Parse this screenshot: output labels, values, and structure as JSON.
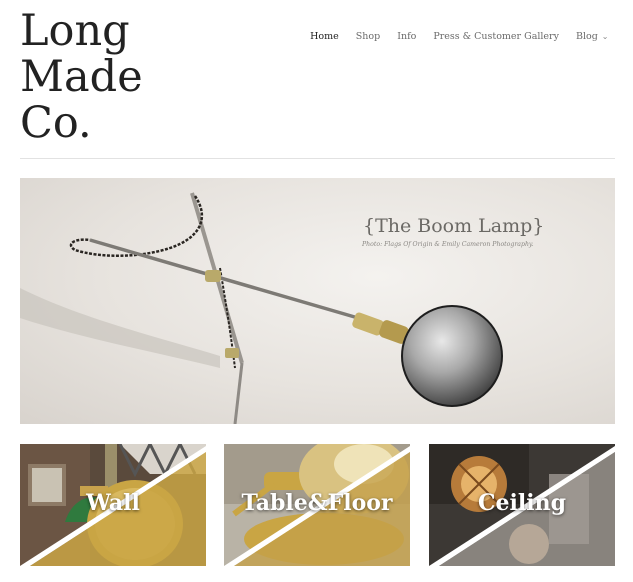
{
  "brand": {
    "line1": "Long",
    "line2": "Made",
    "line3": "Co."
  },
  "nav": {
    "items": [
      {
        "label": "Home"
      },
      {
        "label": "Shop"
      },
      {
        "label": "Info"
      },
      {
        "label": "Press & Customer Gallery"
      },
      {
        "label": "Blog"
      }
    ]
  },
  "hero": {
    "title": "{The Boom Lamp}",
    "credit": "Photo: Flags Of Origin & Emily Cameron Photography."
  },
  "tiles": [
    {
      "label": "Wall"
    },
    {
      "label": "Table&Floor"
    },
    {
      "label": "Ceiling"
    }
  ],
  "colors": {
    "text": "#222222",
    "nav": "#6a6a6a",
    "rule": "#e2e2e2"
  }
}
